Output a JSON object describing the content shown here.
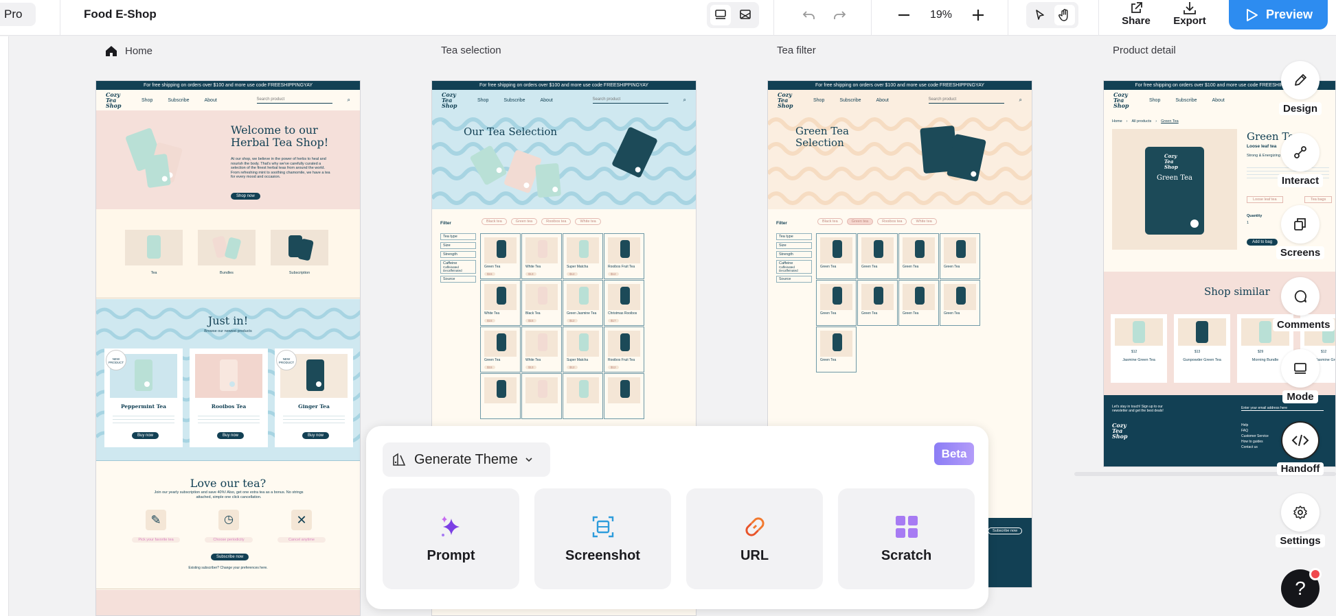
{
  "topbar": {
    "plan_label": "Pro",
    "project_name": "Food E-Shop",
    "zoom": "19%",
    "share_label": "Share",
    "export_label": "Export",
    "preview_label": "Preview"
  },
  "frames": [
    {
      "title": "Home"
    },
    {
      "title": "Tea selection"
    },
    {
      "title": "Tea filter"
    },
    {
      "title": "Product detail"
    }
  ],
  "mock": {
    "banner": "For free shipping on orders over $100 and more use code FREESHIPPINGYAY",
    "logo": "Cozy Tea Shop",
    "nav": [
      "Shop",
      "Subscribe",
      "About"
    ],
    "search_placeholder": "Search product",
    "home": {
      "hero_title": "Welcome to our Herbal Tea Shop!",
      "hero_body": "At our shop, we believe in the power of herbs to heal and nourish the body. That's why we've carefully curated a selection of the finest herbal teas from around the world. From refreshing mint to soothing chamomile, we have a tea for every mood and occasion.",
      "shop_now": "Shop now",
      "categories": [
        "Tea",
        "Bundles",
        "Subscription"
      ],
      "just_in_title": "Just in!",
      "just_in_sub": "Browse our newest products",
      "new_badge": "NEW PRODUCT",
      "products": [
        "Peppermint Tea",
        "Rooibos Tea",
        "Ginger Tea"
      ],
      "buy_now": "Buy now",
      "love_title": "Love our tea?",
      "love_body": "Join our yearly subscription and save 40%! Also, get one extra tea as a bonus. No strings attached, simple one click cancellation.",
      "steps": [
        "Pick your favorite tea",
        "Choose periodicity",
        "Cancel anytime"
      ],
      "subscribe_now": "Subscribe now",
      "existing": "Existing subscriber? Change your preferences here."
    },
    "selection": {
      "title": "Our Tea Selection",
      "filter": "Filter",
      "chips": [
        "Black tea",
        "Green tea",
        "Rooibos tea",
        "White tea"
      ],
      "filters": [
        "Tea type",
        "Size",
        "Strength",
        "Caffeine",
        "Source"
      ],
      "caffeine_opts": [
        "Caffeinated",
        "Decaffeinated"
      ],
      "items": [
        "Green Tea",
        "White Tea",
        "Super Matcha",
        "Rooibos Fruit Tea",
        "White Tea",
        "Black Tea",
        "Green Jasmine Tea",
        "Christmas Rooibos",
        "Green Tea",
        "White Tea",
        "Super Matcha",
        "Rooibos Fruit Tea"
      ],
      "prices": [
        "$15",
        "$13",
        "$12",
        "$12",
        "$15",
        "$15",
        "$12",
        "$17",
        "$15",
        "$13",
        "$12",
        "$12"
      ]
    },
    "filter_page": {
      "title": "Green Tea Selection",
      "item": "Green Tea",
      "subscribe_now": "Subscribe now"
    },
    "detail": {
      "breadcrumb": [
        "Home",
        "All products",
        "Green Tea"
      ],
      "title": "Green Tea",
      "subtitle": "Loose leaf tea",
      "tagline": "Strong & Energizing",
      "pack_label": "Green Tea",
      "options": [
        "Loose leaf tea",
        "Tea bags"
      ],
      "quantity_label": "Quantity",
      "quantity": "1",
      "add_to_bag": "Add to bag",
      "shop_similar": "Shop similar",
      "similar": [
        "Jasmine Green Tea",
        "Gunpowder Green Tea",
        "Morning Bundle",
        "Jasmine Green"
      ],
      "similar_prices": [
        "$12",
        "$13",
        "$29",
        "$12"
      ],
      "footer_text": "Let's stay in touch! Sign up to our newsletter and get the best deals!",
      "footer_email": "Enter your email address here",
      "footer_links": [
        "Help",
        "FAQ",
        "Customer Service",
        "How to guides",
        "Contact us"
      ]
    }
  },
  "sidebar": {
    "items": [
      {
        "label": "Design",
        "icon": "pencil-icon"
      },
      {
        "label": "Interact",
        "icon": "interact-icon"
      },
      {
        "label": "Screens",
        "icon": "screens-icon"
      },
      {
        "label": "Comments",
        "icon": "comment-icon"
      },
      {
        "label": "Mode",
        "icon": "mode-icon"
      },
      {
        "label": "Handoff",
        "icon": "code-icon"
      },
      {
        "label": "Settings",
        "icon": "gear-icon"
      }
    ]
  },
  "generate_panel": {
    "dropdown_label": "Generate Theme",
    "beta_label": "Beta",
    "options": [
      {
        "label": "Prompt",
        "icon": "sparkle-icon",
        "color": "#7b3fe4"
      },
      {
        "label": "Screenshot",
        "icon": "screenshot-icon",
        "color": "#2d9cdb"
      },
      {
        "label": "URL",
        "icon": "link-icon",
        "color": "#f2792e"
      },
      {
        "label": "Scratch",
        "icon": "grid-icon",
        "color": "#a77bf3"
      }
    ]
  },
  "help_label": "?"
}
